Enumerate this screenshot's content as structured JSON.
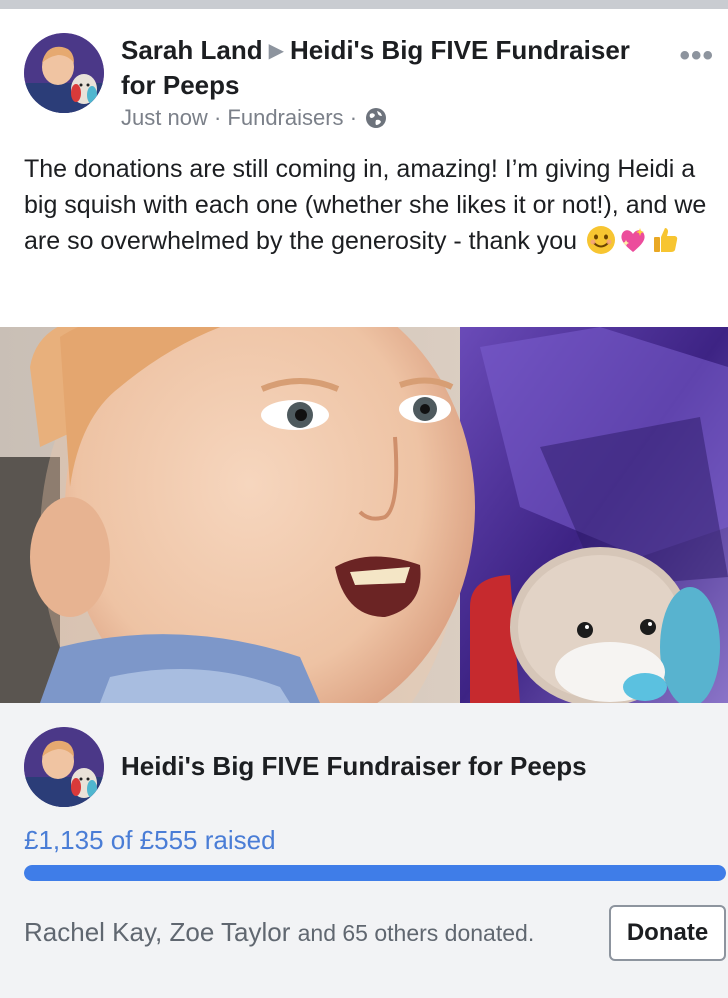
{
  "post": {
    "author": "Sarah Land",
    "separator_icon": "triangle-right-icon",
    "target": "Heidi's Big FIVE Fundraiser for Peeps",
    "time": "Just now",
    "dot": "·",
    "category": "Fundraisers",
    "privacy_icon": "globe-icon",
    "more_icon": "more-dots-icon",
    "more_glyph": "•••",
    "text": "The donations are still coming in, amazing! I’m giving Heidi a big squish with each one (whether she likes it or not!), and we are so overwhelmed by the generosity - thank you",
    "emojis": [
      "smiling-face-emoji",
      "sparkling-heart-emoji",
      "thumbs-up-emoji"
    ]
  },
  "fundraiser": {
    "title": "Heidi's Big FIVE Fundraiser for Peeps",
    "raised_text": "£1,135 of £555 raised",
    "progress_fraction": 1.0,
    "donors_names": "Rachel Kay, Zoe Taylor",
    "donors_rest": "and 65 others donated.",
    "donate_label": "Donate"
  },
  "colors": {
    "accent": "#3f7de8",
    "raised_text": "#4a7dd6",
    "card_bg": "#f2f3f5"
  }
}
